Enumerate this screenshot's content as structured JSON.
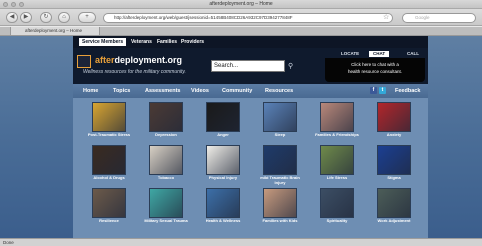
{
  "browser": {
    "window_title": "afterdeployment.org – Home",
    "url": "http://afterdeployment.org/web/guest/jsessionid=51458B408CD26A932C97D394277848F",
    "search_placeholder": "Google",
    "tab_label": "afterdeployment.org – Home",
    "status": "Done",
    "back_glyph": "◀",
    "forward_glyph": "▶",
    "reload_glyph": "↻",
    "home_glyph": "⌂",
    "add_glyph": "+",
    "bookmark_glyph": "☆"
  },
  "site": {
    "top_tabs": [
      "Service Members",
      "Veterans",
      "Families",
      "Providers"
    ],
    "logo": {
      "prefix": "after",
      "suffix": "deployment.org"
    },
    "tagline": "Wellness resources for the military community.",
    "search_placeholder": "Search...",
    "search_icon": "magnifier-icon",
    "contact": [
      "LOCATE",
      "CHAT",
      "CALL"
    ],
    "chat_text_1": "Click here to chat with a",
    "chat_text_2": "health resource consultant.",
    "nav": [
      "Home",
      "Topics",
      "Assessments",
      "Videos",
      "Community",
      "Resources"
    ],
    "feedback": "Feedback",
    "social": {
      "facebook": "f",
      "twitter": "t"
    }
  },
  "topics": [
    {
      "label": "Post-Traumatic Stress",
      "color": "#d9a531"
    },
    {
      "label": "Depression",
      "color": "#4b3a34"
    },
    {
      "label": "Anger",
      "color": "#1a1a1a"
    },
    {
      "label": "Sleep",
      "color": "#5a82b8"
    },
    {
      "label": "Families & Friendships",
      "color": "#b9887a"
    },
    {
      "label": "Anxiety",
      "color": "#b2262a"
    },
    {
      "label": "Alcohol & Drugs",
      "color": "#3a2a20"
    },
    {
      "label": "Tobacco",
      "color": "#d8d0c4"
    },
    {
      "label": "Physical Injury",
      "color": "#f0eee8"
    },
    {
      "label": "mild Traumatic Brain Injury",
      "color": "#1f3b6a"
    },
    {
      "label": "Life Stress",
      "color": "#6f8a4a"
    },
    {
      "label": "Stigma",
      "color": "#1b3f92"
    },
    {
      "label": "Resilience",
      "color": "#6c5a4a"
    },
    {
      "label": "Military Sexual Trauma",
      "color": "#3fa7a4"
    },
    {
      "label": "Health & Wellness",
      "color": "#3c6fa8"
    },
    {
      "label": "Families with Kids",
      "color": "#c79a7e"
    },
    {
      "label": "Spirituality",
      "color": "#3c4e64"
    },
    {
      "label": "Work Adjustment",
      "color": "#4c5d58"
    }
  ]
}
